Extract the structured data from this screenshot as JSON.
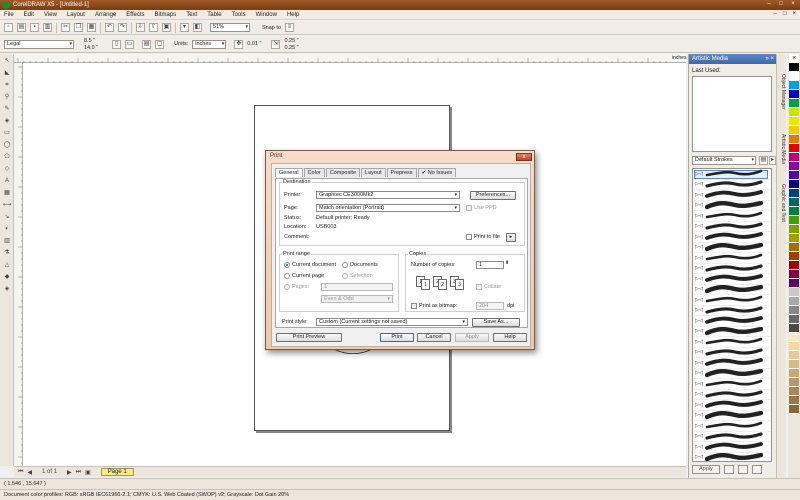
{
  "window": {
    "title": "CorelDRAW X5 - [Untitled-1]",
    "controls": [
      "–",
      "□",
      "×"
    ]
  },
  "menu": [
    "File",
    "Edit",
    "View",
    "Layout",
    "Arrange",
    "Effects",
    "Bitmaps",
    "Text",
    "Table",
    "Tools",
    "Window",
    "Help"
  ],
  "toolbar": {
    "zoom": "51%",
    "snap_to": "Snap to"
  },
  "propbar": {
    "paper": "Legal",
    "width": "8.5 \"",
    "height": "14.0 \"",
    "units_label": "Units:",
    "units": "inches",
    "nudge": "0.01 \"",
    "dup_x": "0.25 \"",
    "dup_y": "0.25 \""
  },
  "ruler": {
    "unit": "inches"
  },
  "pagenav": {
    "counter": "1 of 1",
    "page_tab": "Page 1"
  },
  "status": {
    "coords": "( 1.546 , 15.647 )",
    "profiles": "Document color profiles: RGB: sRGB IEC61966-2.1; CMYK: U.S. Web Coated (SWOP) v2; Grayscale: Dot Gain 20%"
  },
  "docker": {
    "title": "Artistic Media",
    "last_used": "Last Used:",
    "strokes_combo": "Default Strokes",
    "apply": "Apply",
    "side_tabs": [
      "Object Manager",
      "Artistic Media",
      "Graphic and Text"
    ]
  },
  "palette": {
    "colors": [
      "#ffffff",
      "#000000",
      "#ffffff",
      "#00a0e8",
      "#0000c8",
      "#00a050",
      "#c8e800",
      "#e8e800",
      "#f8c800",
      "#e87800",
      "#e80000",
      "#c00078",
      "#9000a8",
      "#5000a0",
      "#000080",
      "#004080",
      "#006868",
      "#008040",
      "#40a000",
      "#80a000",
      "#a0a000",
      "#a07000",
      "#a04000",
      "#a00000",
      "#800040",
      "#600060",
      "#c8c8c8",
      "#a8a8a8",
      "#888888",
      "#686868",
      "#484848",
      "#f8e8c8",
      "#f8d8a8",
      "#e8c898",
      "#d8b888",
      "#c8a878",
      "#b89868",
      "#a88858",
      "#987848",
      "#886838"
    ]
  },
  "dialog": {
    "title": "Print",
    "close": "x",
    "tabs": [
      "General",
      "Color",
      "Composite",
      "Layout",
      "Prepress",
      "No Issues"
    ],
    "destination": {
      "heading": "Destination",
      "printer_label": "Printer:",
      "printer": "Graphtec CE3000Mk2",
      "preferences": "Preferences...",
      "page_label": "Page:",
      "page": "Match orientation (Portrait)",
      "use_ppd": "Use PPD",
      "status_label": "Status:",
      "status": "Default printer; Ready",
      "location_label": "Location:",
      "location": "USB003",
      "comment_label": "Comment:",
      "print_to_file": "Print to file"
    },
    "range": {
      "heading": "Print range",
      "current_document": "Current document",
      "documents": "Documents",
      "current_page": "Current page",
      "selection": "Selection",
      "pages": "Pages:",
      "pages_value": "1",
      "even_odd": "Even & Odd"
    },
    "copies": {
      "heading": "Copies",
      "number_label": "Number of copies:",
      "number": "1",
      "collate": "Collate",
      "print_as_bitmap": "Print as bitmap:",
      "dpi_value": "204",
      "dpi": "dpi",
      "page_icons": [
        "1",
        "1",
        "2",
        "2",
        "3",
        "3"
      ]
    },
    "style": {
      "label": "Print style:",
      "value": "Custom (Current settings not saved)",
      "save_as": "Save As..."
    },
    "buttons": {
      "preview": "Print Preview",
      "print": "Print",
      "cancel": "Cancel",
      "apply": "Apply",
      "help": "Help"
    }
  }
}
